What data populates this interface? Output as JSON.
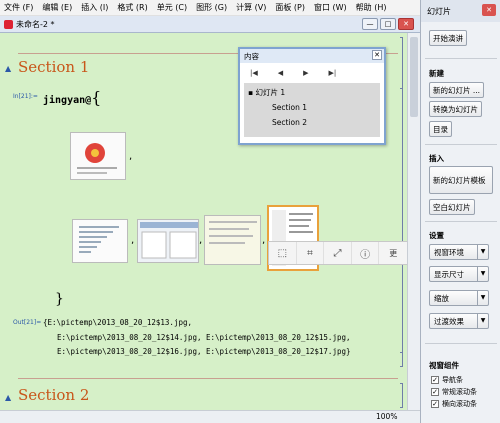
{
  "menu": [
    "文件 (F)",
    "编辑 (E)",
    "插入 (I)",
    "格式 (R)",
    "单元 (C)",
    "图形 (G)",
    "计算 (V)",
    "面板 (P)",
    "窗口 (W)",
    "帮助 (H)"
  ],
  "tab": {
    "title": "未命名-2 *"
  },
  "window_buttons": {
    "minimize": "—",
    "restore": "□",
    "close": "✕"
  },
  "notebook": {
    "section1": "Section 1",
    "section2": "Section 2",
    "in_label": "In[21]:=",
    "input_code": "jingyan@",
    "open_brace": "{",
    "close_brace": "}",
    "out_label": "Out[21]=",
    "output_lines": [
      "{E:\\pictemp\\2013_08_20_12$13.jpg,",
      "E:\\pictemp\\2013_08_20_12$14.jpg, E:\\pictemp\\2013_08_20_12$15.jpg,",
      "E:\\pictemp\\2013_08_20_12$16.jpg, E:\\pictemp\\2013_08_20_12$17.jpg}"
    ],
    "comma": ","
  },
  "image_toolbar": {
    "crop": "⬚",
    "trim": "⌗",
    "resize": "⤢",
    "info": "ⓘ",
    "more": "更"
  },
  "contents": {
    "title": "内容",
    "close": "✕",
    "nav": [
      "|◀",
      "◀",
      "▶",
      "▶|"
    ],
    "items": [
      "▪ 幻灯片 1",
      "Section 1",
      "Section 2"
    ]
  },
  "status": {
    "zoom": "100%"
  },
  "slideshow_palette": {
    "title": "幻灯片",
    "close": "✕",
    "start_button": "开始演讲",
    "new_heading": "新建",
    "new_slide": "新的幻灯片 ...",
    "convert_slide": "转换为幻灯片",
    "toc": "目录",
    "insert_heading": "插入",
    "new_template_slide": "新的幻灯片模板",
    "blank_slide": "空白幻灯片",
    "settings_heading": "设置",
    "view_env": "视窗环境",
    "display_size": "显示尺寸",
    "zoom": "缩放",
    "transition": "过渡效果",
    "window_components_heading": "视窗组件",
    "checkboxes": [
      "导航条",
      "常规滚动条",
      "横向滚动条"
    ]
  }
}
